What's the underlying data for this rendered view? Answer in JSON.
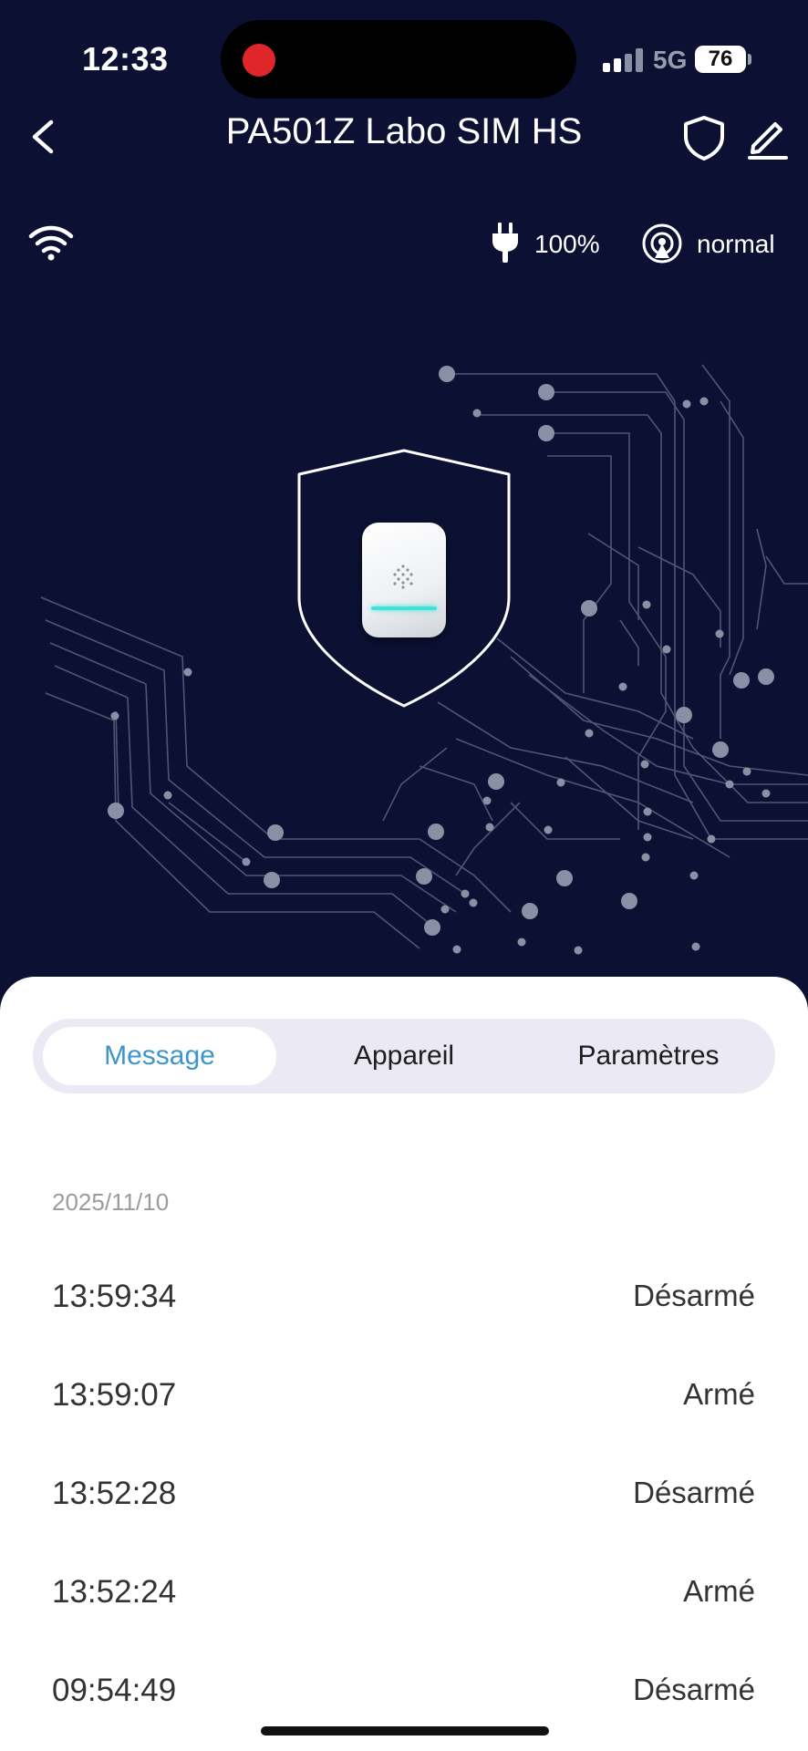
{
  "status_bar": {
    "time": "12:33",
    "network": "5G",
    "battery": "76"
  },
  "header": {
    "title": "PA501Z Labo SIM HS"
  },
  "device_status": {
    "power": "100%",
    "mode": "normal"
  },
  "tabs": [
    {
      "label": "Message",
      "active": true
    },
    {
      "label": "Appareil",
      "active": false
    },
    {
      "label": "Paramètres",
      "active": false
    }
  ],
  "log": {
    "date": "2025/11/10",
    "entries": [
      {
        "time": "13:59:34",
        "state": "Désarmé"
      },
      {
        "time": "13:59:07",
        "state": "Armé"
      },
      {
        "time": "13:52:28",
        "state": "Désarmé"
      },
      {
        "time": "13:52:24",
        "state": "Armé"
      },
      {
        "time": "09:54:49",
        "state": "Désarmé"
      }
    ]
  },
  "icons": {
    "back": "chevron-left-icon",
    "shield": "shield-icon",
    "edit": "pencil-icon",
    "wifi": "wifi-icon",
    "plug": "plug-icon",
    "antenna": "antenna-icon"
  },
  "colors": {
    "background": "#0c1133",
    "tab_active_text": "#3c97c8",
    "tab_track": "#ebe9f4",
    "recording": "#e0262a",
    "device_led": "#3de3db"
  }
}
